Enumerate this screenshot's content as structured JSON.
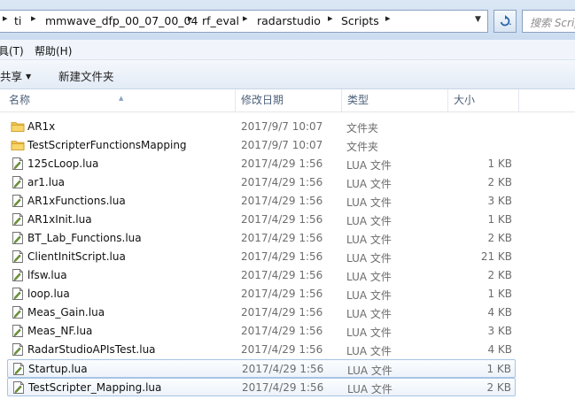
{
  "address": {
    "crumbs": [
      "ti",
      "mmwave_dfp_00_07_00_04",
      "rf_eval",
      "radarstudio",
      "Scripts"
    ],
    "search_placeholder": "搜索 Scripts"
  },
  "menubar": {
    "tools": "具(T)",
    "help": "帮助(H)"
  },
  "toolbar": {
    "share": "共享",
    "new_folder": "新建文件夹"
  },
  "columns": {
    "name": "名称",
    "date": "修改日期",
    "type": "类型",
    "size": "大小"
  },
  "files": [
    {
      "name": "AR1x",
      "date": "2017/9/7 10:07",
      "type": "文件夹",
      "size": "",
      "icon": "folder-icon"
    },
    {
      "name": "TestScripterFunctionsMapping",
      "date": "2017/9/7 10:07",
      "type": "文件夹",
      "size": "",
      "icon": "folder-icon"
    },
    {
      "name": "125cLoop.lua",
      "date": "2017/4/29 1:56",
      "type": "LUA 文件",
      "size": "1 KB",
      "icon": "lua-file-icon"
    },
    {
      "name": "ar1.lua",
      "date": "2017/4/29 1:56",
      "type": "LUA 文件",
      "size": "2 KB",
      "icon": "lua-file-icon"
    },
    {
      "name": "AR1xFunctions.lua",
      "date": "2017/4/29 1:56",
      "type": "LUA 文件",
      "size": "3 KB",
      "icon": "lua-file-icon"
    },
    {
      "name": "AR1xInit.lua",
      "date": "2017/4/29 1:56",
      "type": "LUA 文件",
      "size": "1 KB",
      "icon": "lua-file-icon"
    },
    {
      "name": "BT_Lab_Functions.lua",
      "date": "2017/4/29 1:56",
      "type": "LUA 文件",
      "size": "2 KB",
      "icon": "lua-file-icon"
    },
    {
      "name": "ClientInitScript.lua",
      "date": "2017/4/29 1:56",
      "type": "LUA 文件",
      "size": "21 KB",
      "icon": "lua-file-icon"
    },
    {
      "name": "lfsw.lua",
      "date": "2017/4/29 1:56",
      "type": "LUA 文件",
      "size": "2 KB",
      "icon": "lua-file-icon"
    },
    {
      "name": "loop.lua",
      "date": "2017/4/29 1:56",
      "type": "LUA 文件",
      "size": "1 KB",
      "icon": "lua-file-icon"
    },
    {
      "name": "Meas_Gain.lua",
      "date": "2017/4/29 1:56",
      "type": "LUA 文件",
      "size": "4 KB",
      "icon": "lua-file-icon"
    },
    {
      "name": "Meas_NF.lua",
      "date": "2017/4/29 1:56",
      "type": "LUA 文件",
      "size": "3 KB",
      "icon": "lua-file-icon"
    },
    {
      "name": "RadarStudioAPIsTest.lua",
      "date": "2017/4/29 1:56",
      "type": "LUA 文件",
      "size": "4 KB",
      "icon": "lua-file-icon"
    },
    {
      "name": "Startup.lua",
      "date": "2017/4/29 1:56",
      "type": "LUA 文件",
      "size": "1 KB",
      "icon": "lua-file-icon",
      "selected": true
    },
    {
      "name": "TestScripter_Mapping.lua",
      "date": "2017/4/29 1:56",
      "type": "LUA 文件",
      "size": "2 KB",
      "icon": "lua-file-icon",
      "selected": true
    }
  ]
}
